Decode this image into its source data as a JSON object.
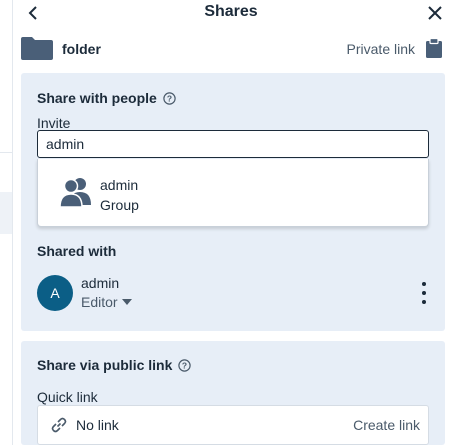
{
  "header": {
    "title": "Shares"
  },
  "resource": {
    "name": "folder",
    "private_link_label": "Private link"
  },
  "share_people": {
    "title": "Share with people",
    "invite_label": "Invite",
    "invite_value": "admin",
    "suggestion": {
      "name": "admin",
      "type": "Group"
    },
    "shared_with_title": "Shared with",
    "collaborators": [
      {
        "initial": "A",
        "name": "admin",
        "role": "Editor"
      }
    ]
  },
  "public_link": {
    "title": "Share via public link",
    "quick_link_label": "Quick link",
    "status": "No link",
    "create_label": "Create link"
  },
  "colors": {
    "accent": "#0b5e86",
    "card_bg": "#e7eef7",
    "text": "#1c2b3a",
    "icon": "#4a5f78"
  },
  "icons": {
    "back": "chevron-left-icon",
    "close": "close-icon",
    "folder": "folder-icon",
    "clipboard": "clipboard-icon",
    "help": "help-circle-icon",
    "group": "group-icon",
    "caret": "caret-down-icon",
    "more": "kebab-menu-icon",
    "link": "link-off-icon"
  }
}
